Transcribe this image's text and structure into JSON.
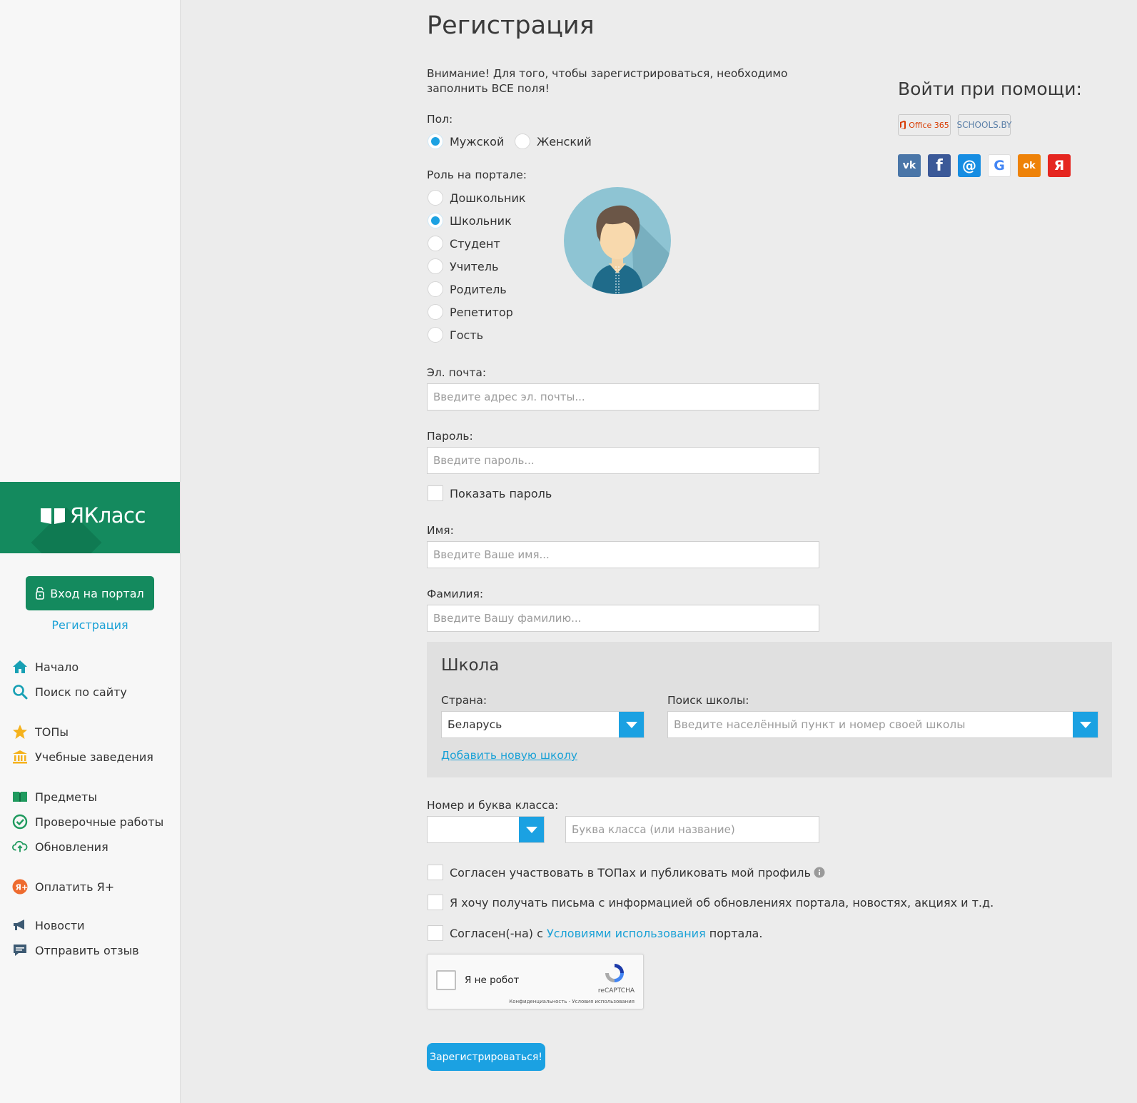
{
  "sidebar": {
    "logo_text": "ЯКласс",
    "login_button": "Вход на портал",
    "register_link": "Регистрация",
    "items": [
      {
        "label": "Начало",
        "icon": "home-icon"
      },
      {
        "label": "Поиск по сайту",
        "icon": "search-icon"
      },
      {
        "label": "ТОПы",
        "icon": "star-icon"
      },
      {
        "label": "Учебные заведения",
        "icon": "institution-icon"
      },
      {
        "label": "Предметы",
        "icon": "books-icon"
      },
      {
        "label": "Проверочные работы",
        "icon": "check-circle-icon"
      },
      {
        "label": "Обновления",
        "icon": "cloud-upload-icon"
      },
      {
        "label": "Оплатить Я+",
        "icon": "ya-plus-icon"
      },
      {
        "label": "Новости",
        "icon": "megaphone-icon"
      },
      {
        "label": "Отправить отзыв",
        "icon": "feedback-icon"
      }
    ]
  },
  "form": {
    "title": "Регистрация",
    "warning": "Внимание! Для того, чтобы зарегистрироваться, необходимо заполнить ВСЕ поля!",
    "gender_label": "Пол:",
    "gender_options": [
      "Мужской",
      "Женский"
    ],
    "gender_selected": "Мужской",
    "role_label": "Роль на портале:",
    "role_options": [
      "Дошкольник",
      "Школьник",
      "Студент",
      "Учитель",
      "Родитель",
      "Репетитор",
      "Гость"
    ],
    "role_selected": "Школьник",
    "email_label": "Эл. почта:",
    "email_placeholder": "Введите адрес эл. почты...",
    "password_label": "Пароль:",
    "password_placeholder": "Введите пароль...",
    "show_password": "Показать пароль",
    "name_label": "Имя:",
    "name_placeholder": "Введите Ваше имя...",
    "surname_label": "Фамилия:",
    "surname_placeholder": "Введите Вашу фамилию...",
    "school": {
      "title": "Школа",
      "country_label": "Страна:",
      "country_value": "Беларусь",
      "search_label": "Поиск школы:",
      "search_placeholder": "Введите населённый пункт и номер своей школы",
      "add_school_link": "Добавить новую школу"
    },
    "class_label": "Номер и буква класса:",
    "class_letter_placeholder": "Буква класса (или название)",
    "consent_tops": "Согласен участвовать в ТОПах и публиковать мой профиль",
    "consent_news": "Я хочу получать письма с информацией об обновлениях портала, новостях, акциях и т.д.",
    "consent_terms_prefix": "Согласен(-на) с",
    "consent_terms_link": "Условиями использования",
    "consent_terms_suffix": "портала.",
    "captcha": {
      "label": "Я не робот",
      "brand": "reCAPTCHA",
      "terms": "Конфиденциальность - Условия использования"
    },
    "submit": "Зарегистрироваться!"
  },
  "social": {
    "title": "Войти при помощи:",
    "office_label": "Office 365",
    "schools_label": "SCHOOLS.BY",
    "networks": [
      {
        "name": "vk",
        "glyph": "vk",
        "color": "#4a76a8"
      },
      {
        "name": "facebook",
        "glyph": "f",
        "color": "#3b5998"
      },
      {
        "name": "mail",
        "glyph": "@",
        "color": "#168de2"
      },
      {
        "name": "google",
        "glyph": "G",
        "color": "#ffffff"
      },
      {
        "name": "ok",
        "glyph": "ok",
        "color": "#ee8208"
      },
      {
        "name": "yandex",
        "glyph": "Я",
        "color": "#e52620"
      }
    ]
  },
  "colors": {
    "brand_green": "#148a5e",
    "accent_blue": "#1ba1e2",
    "link_blue": "#1aa1d6"
  }
}
